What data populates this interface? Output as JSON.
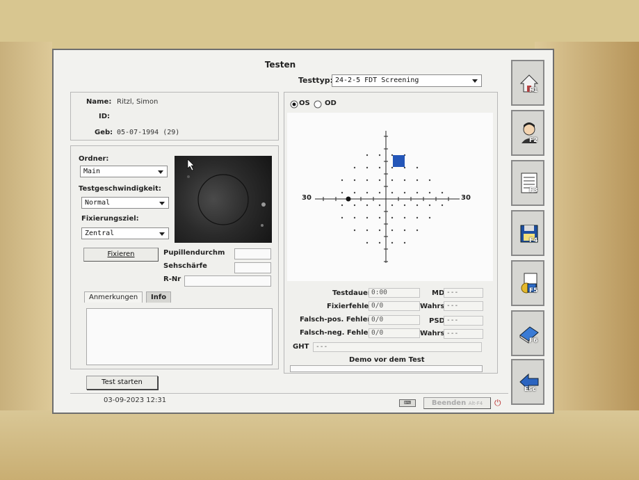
{
  "app": {
    "title": "Testen"
  },
  "testtyp": {
    "label": "Testtyp:",
    "value": "24-2-5 FDT Screening"
  },
  "patient": {
    "name_label": "Name:",
    "name": "Ritzl, Simon",
    "id_label": "ID:",
    "id": "",
    "geb_label": "Geb:",
    "geb": "05-07-1994 (29)"
  },
  "form": {
    "ordner_label": "Ordner:",
    "ordner_value": "Main",
    "speed_label": "Testgeschwindigkeit:",
    "speed_value": "Normal",
    "fix_label": "Fixierungsziel:",
    "fix_value": "Zentral",
    "fixieren_button": "Fixieren",
    "pupil_label": "Pupillendurchm",
    "sehschaerfe_label": "Sehschärfe",
    "rnr_label": "R-Nr"
  },
  "tabs": {
    "anmerkungen": "Anmerkungen",
    "info": "Info"
  },
  "eye": {
    "os": "OS",
    "od": "OD",
    "selected": "OS"
  },
  "plot": {
    "left_label": "30",
    "right_label": "30"
  },
  "results": {
    "testdauer_label": "Testdauer",
    "testdauer": "0:00",
    "fixierfehler_label": "Fixierfehler",
    "fixierfehler": "0/0",
    "falsch_pos_label": "Falsch-pos. Fehler",
    "falsch_pos": "0/0",
    "falsch_neg_label": "Falsch-neg. Fehler",
    "falsch_neg": "0/0",
    "md_label": "MD",
    "md": "---",
    "wahrs1_label": "Wahrs",
    "wahrs1": "---",
    "psd_label": "PSD",
    "psd": "---",
    "wahrs2_label": "Wahrs",
    "wahrs2": "---",
    "ght_label": "GHT",
    "ght": "---",
    "status_text": "Demo vor dem Test"
  },
  "buttons": {
    "test_starten": "Test starten",
    "beenden": "Beenden",
    "beenden_key": "Alt-F4"
  },
  "statusbar": {
    "datetime": "03-09-2023 12:31"
  },
  "sidebar": [
    {
      "icon": "home-icon",
      "key": "F1"
    },
    {
      "icon": "patient-icon",
      "key": "F2"
    },
    {
      "icon": "data-sheet-icon",
      "key": "F3"
    },
    {
      "icon": "save-disk-icon",
      "key": "F4"
    },
    {
      "icon": "settings-doc-icon",
      "key": "F5"
    },
    {
      "icon": "print-book-icon",
      "key": "F6"
    },
    {
      "icon": "exit-arrow-icon",
      "key": "Esc"
    }
  ]
}
